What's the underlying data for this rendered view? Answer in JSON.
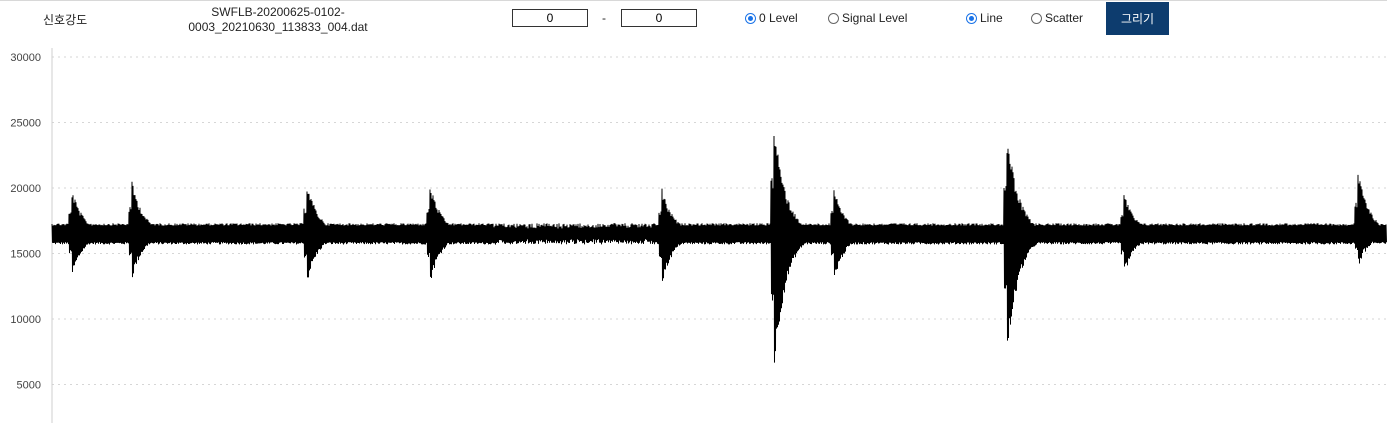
{
  "toolbar": {
    "title": "신호강도",
    "filename_line1": "SWFLB-20200625-0102-",
    "filename_line2": "0003_20210630_113833_004.dat",
    "range_from": "0",
    "range_separator": "-",
    "range_to": "0",
    "level_options": [
      {
        "label": "0 Level",
        "checked": true
      },
      {
        "label": "Signal Level",
        "checked": false
      }
    ],
    "mode_options": [
      {
        "label": "Line",
        "checked": true
      },
      {
        "label": "Scatter",
        "checked": false
      }
    ],
    "draw_label": "그리기",
    "accent_color": "#1a73e8",
    "button_color": "#0d3c6e"
  },
  "chart_data": {
    "type": "line",
    "title": "",
    "xlabel": "",
    "ylabel": "",
    "ylim": [
      2000,
      30000
    ],
    "yticks": [
      "30000",
      "25000",
      "20000",
      "15000",
      "10000",
      "5000"
    ],
    "grid": "horizontal dotted",
    "line_color": "#000000",
    "baseline": 16500,
    "sample_count": 1335,
    "bursts": [
      {
        "x": 20,
        "max": 20300,
        "min": 12900
      },
      {
        "x": 80,
        "max": 21000,
        "min": 12700
      },
      {
        "x": 255,
        "max": 20900,
        "min": 12400
      },
      {
        "x": 378,
        "max": 20800,
        "min": 12400
      },
      {
        "x": 610,
        "max": 20400,
        "min": 12300
      },
      {
        "x": 722,
        "max": 26400,
        "min": 5100
      },
      {
        "x": 782,
        "max": 20400,
        "min": 12600
      },
      {
        "x": 955,
        "max": 25300,
        "min": 6200
      },
      {
        "x": 1072,
        "max": 20000,
        "min": 13000
      },
      {
        "x": 1306,
        "max": 21700,
        "min": 13500
      }
    ]
  }
}
